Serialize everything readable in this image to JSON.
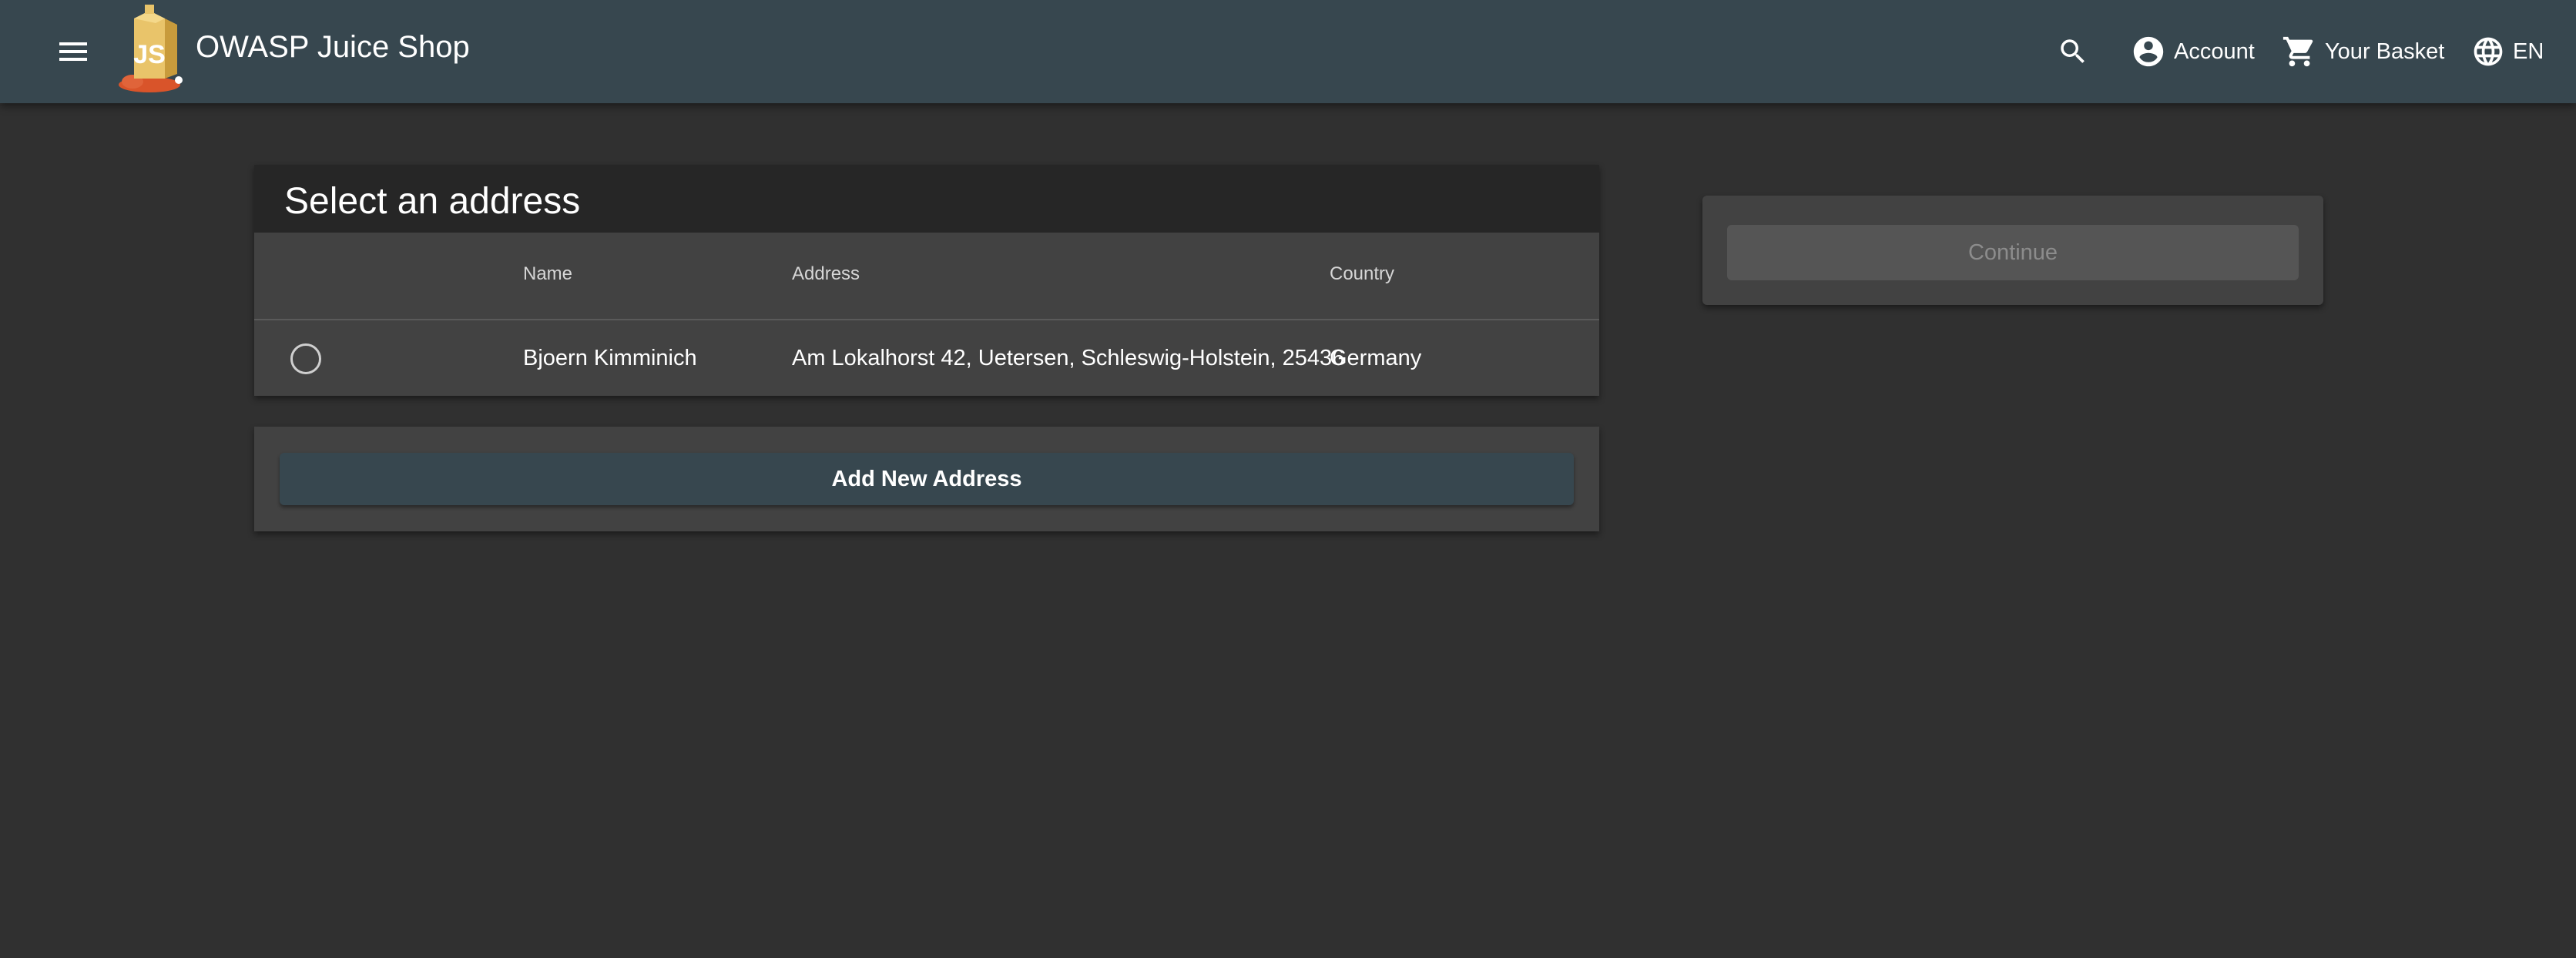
{
  "header": {
    "app_title": "OWASP Juice Shop",
    "logo_text": "JS",
    "account_label": "Account",
    "basket_label": "Your Basket",
    "language_label": "EN",
    "bar_color": "#37474f"
  },
  "icons": {
    "menu": "hamburger-menu-icon",
    "search": "search-icon",
    "account": "account-circle-icon",
    "basket": "shopping-cart-icon",
    "language": "globe-icon"
  },
  "address_card": {
    "title": "Select an address",
    "columns": {
      "name": "Name",
      "address": "Address",
      "country": "Country"
    },
    "rows": [
      {
        "selected": false,
        "name": "Bjoern Kimminich",
        "address": "Am Lokalhorst 42, Uetersen, Schleswig-Holstein, 25436",
        "country": "Germany"
      }
    ]
  },
  "add_address_button": "Add New Address",
  "continue_button": {
    "label": "Continue",
    "disabled": true
  }
}
